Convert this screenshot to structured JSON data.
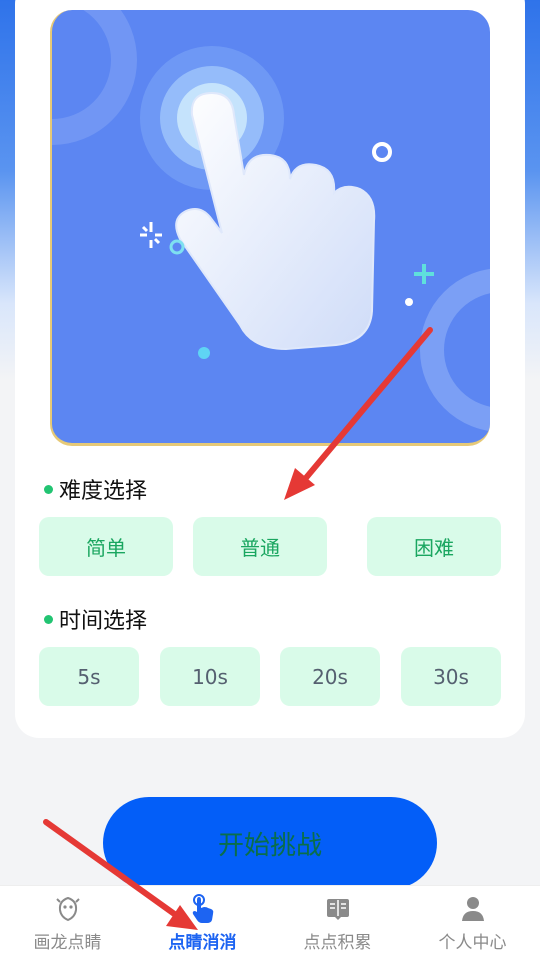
{
  "colors": {
    "accent": "#035ef8",
    "chip_bg": "#d9fbe9",
    "chip_text_green": "#1aa660",
    "tab_active": "#1d64f2",
    "annotation_arrow": "#e53935"
  },
  "difficulty": {
    "title": "难度选择",
    "options": [
      "简单",
      "普通",
      "困难"
    ]
  },
  "time": {
    "title": "时间选择",
    "options": [
      "5s",
      "10s",
      "20s",
      "30s"
    ]
  },
  "start_button": {
    "label": "开始挑战"
  },
  "tabbar": {
    "items": [
      {
        "label": "画龙点睛",
        "icon": "dragon-icon",
        "active": false
      },
      {
        "label": "点睛消消",
        "icon": "tap-hand-icon",
        "active": true
      },
      {
        "label": "点点积累",
        "icon": "book-icon",
        "active": false
      },
      {
        "label": "个人中心",
        "icon": "person-icon",
        "active": false
      }
    ]
  }
}
